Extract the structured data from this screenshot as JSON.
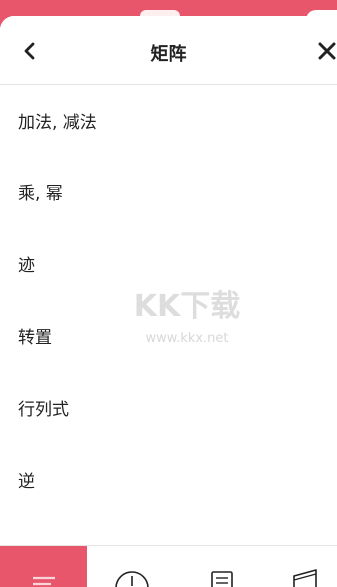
{
  "header": {
    "title": "矩阵",
    "back_icon": "chevron-left-icon",
    "close_icon": "close-icon"
  },
  "menu": {
    "items": [
      {
        "label": "加法, 减法"
      },
      {
        "label": "乘, 幂"
      },
      {
        "label": "迹"
      },
      {
        "label": "转置"
      },
      {
        "label": "行列式"
      },
      {
        "label": "逆"
      }
    ]
  },
  "bottom_nav": {
    "tabs": [
      {
        "icon": "menu-lines-icon",
        "active": true
      },
      {
        "icon": "clock-icon",
        "active": false
      },
      {
        "icon": "document-icon",
        "active": false
      },
      {
        "icon": "music-note-icon",
        "active": false
      }
    ]
  },
  "watermark": {
    "logo": "KK下载",
    "url": "www.kkx.net"
  },
  "colors": {
    "accent": "#e8566c",
    "text": "#222222",
    "divider": "#e2e2e2"
  }
}
